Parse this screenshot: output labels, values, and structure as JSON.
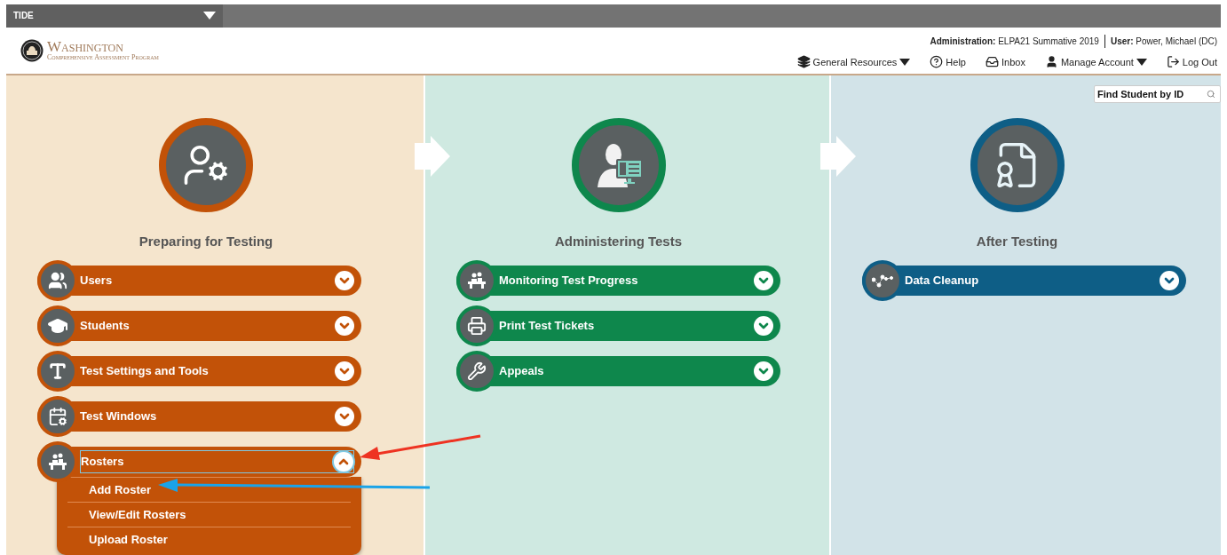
{
  "top_bar": {
    "app_menu": "TIDE"
  },
  "header": {
    "logo": {
      "title": "Washington",
      "subtitle": "Comprehensive Assessment Program"
    },
    "context": [
      {
        "label": "Administration:",
        "value": "ELPA21 Summative 2019"
      },
      {
        "label": "User:",
        "value": "Power, Michael (DC)"
      }
    ],
    "nav": [
      {
        "label": "General Resources",
        "dropdown": true
      },
      {
        "label": "Help",
        "dropdown": false
      },
      {
        "label": "Inbox",
        "dropdown": false
      },
      {
        "label": "Manage Account",
        "dropdown": true
      },
      {
        "label": "Log Out",
        "dropdown": false
      }
    ]
  },
  "search": {
    "placeholder": "Find Student by ID"
  },
  "columns": [
    {
      "title": "Preparing for Testing",
      "color": "#c25208",
      "items": [
        {
          "label": "Users",
          "expanded": false
        },
        {
          "label": "Students",
          "expanded": false
        },
        {
          "label": "Test Settings and Tools",
          "expanded": false
        },
        {
          "label": "Test Windows",
          "expanded": false
        },
        {
          "label": "Rosters",
          "expanded": true,
          "children": [
            {
              "label": "Add Roster"
            },
            {
              "label": "View/Edit Rosters"
            },
            {
              "label": "Upload Roster"
            }
          ]
        }
      ]
    },
    {
      "title": "Administering Tests",
      "color": "#0e874c",
      "items": [
        {
          "label": "Monitoring Test Progress",
          "expanded": false
        },
        {
          "label": "Print Test Tickets",
          "expanded": false
        },
        {
          "label": "Appeals",
          "expanded": false
        }
      ]
    },
    {
      "title": "After Testing",
      "color": "#0e5e86",
      "items": [
        {
          "label": "Data Cleanup",
          "expanded": false
        }
      ]
    }
  ]
}
